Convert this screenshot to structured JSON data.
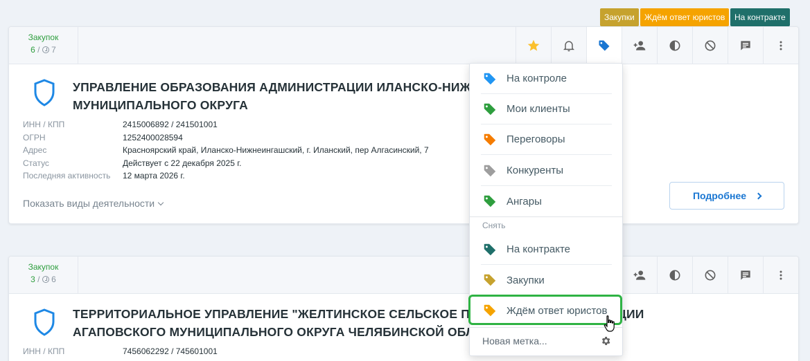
{
  "tags": [
    {
      "label": "Закупки",
      "color": "#c6a22e"
    },
    {
      "label": "Ждём ответ юристов",
      "color": "#f5a300"
    },
    {
      "label": "На контракте",
      "color": "#1f6f6a"
    }
  ],
  "cards": [
    {
      "stats": {
        "label": "Закупок",
        "count": "6",
        "active": "7"
      },
      "name_line1": "УПРАВЛЕНИЕ ОБРАЗОВАНИЯ АДМИНИСТРАЦИИ ИЛАНСКО-НИЖ",
      "name_line2": "МУНИЦИПАЛЬНОГО ОКРУГА",
      "fields": [
        {
          "k": "ИНН / КПП",
          "v": "2415006892 / 241501001"
        },
        {
          "k": "ОГРН",
          "v": "1252400028594"
        },
        {
          "k": "Адрес",
          "v": "Красноярский край, Иланско-Нижнеингашский, г. Иланский, пер Алгасинский, 7"
        },
        {
          "k": "Статус",
          "v": "Действует с 22 декабря 2025 г."
        },
        {
          "k": "Последняя активность",
          "v": "12 марта 2026 г."
        }
      ],
      "show_activities": "Показать виды деятельности",
      "more_label": "Подробнее"
    },
    {
      "stats": {
        "label": "Закупок",
        "count": "3",
        "active": "6"
      },
      "name_line1": "ТЕРРИТОРИАЛЬНОЕ УПРАВЛЕНИЕ \"ЖЕЛТИНСКОЕ СЕЛЬСКОЕ ПОС",
      "name_line1_tail": "ЦИИ",
      "name_line2": "АГАПОВСКОГО МУНИЦИПАЛЬНОГО ОКРУГА ЧЕЛЯБИНСКОЙ ОБЛА",
      "fields": [
        {
          "k": "ИНН / КПП",
          "v": "7456062292 / 745601001"
        }
      ]
    }
  ],
  "dropdown": {
    "items": [
      {
        "label": "На контроле",
        "color": "#2196f3"
      },
      {
        "label": "Мои клиенты",
        "color": "#2e9e3e"
      },
      {
        "label": "Переговоры",
        "color": "#f57c00"
      },
      {
        "label": "Конкуренты",
        "color": "#9e9e9e"
      },
      {
        "label": "Ангары",
        "color": "#2e9e3e"
      }
    ],
    "remove_section": "Снять",
    "remove_items": [
      {
        "label": "На контракте",
        "color": "#1f6f6a"
      },
      {
        "label": "Закупки",
        "color": "#c6a22e"
      },
      {
        "label": "Ждём ответ юристов",
        "color": "#f5a300"
      }
    ],
    "new_label": "Новая метка..."
  },
  "accent": "#1976d2"
}
